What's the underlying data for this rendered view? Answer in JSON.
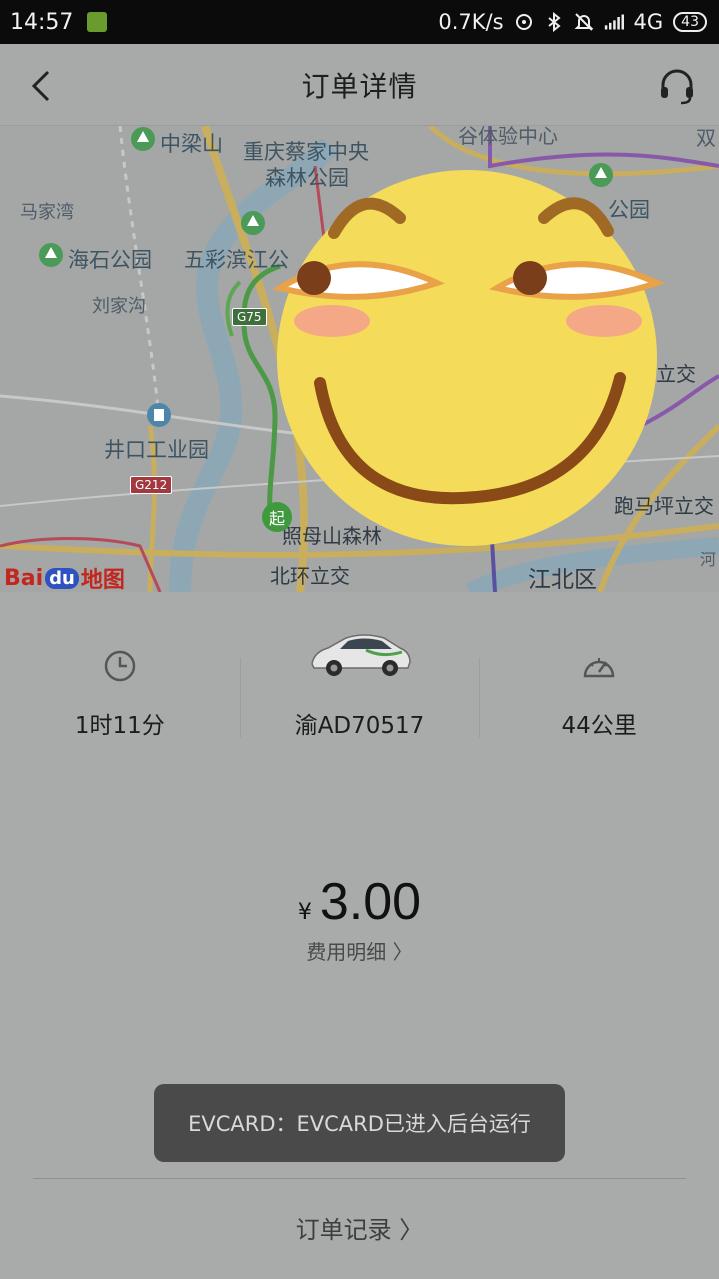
{
  "statusbar": {
    "time": "14:57",
    "speed": "0.7K/s",
    "network": "4G",
    "battery": "43"
  },
  "header": {
    "title": "订单详情"
  },
  "map": {
    "labels": {
      "zhongliangshan": "中梁山",
      "caijia": "重庆蔡家中央",
      "caijia2": "森林公园",
      "tiyan": "谷体验中心",
      "shuang": "双",
      "majiawan": "马家湾",
      "gongyuan_r": "公园",
      "haishi": "海石公园",
      "wucai": "五彩滨江公",
      "liujiagou": "刘家沟",
      "lijiao_r": "立交",
      "jingkou": "井口工业园",
      "paomaping": "跑马坪立交",
      "zhaomushan": "照母山森林",
      "beihuan": "北环立交",
      "jiangbei": "江北区",
      "he": "河"
    },
    "shields": {
      "g75": "G75",
      "g212": "G212"
    },
    "start_marker": "起",
    "logo": {
      "bai": "Bai",
      "du": "du",
      "ditu": "地图"
    }
  },
  "stats": {
    "duration": "1时11分",
    "plate": "渝AD70517",
    "distance": "44公里"
  },
  "price": {
    "currency": "¥",
    "amount": "3.00",
    "detail": "费用明细 〉"
  },
  "toast": {
    "text": "EVCARD：EVCARD已进入后台运行"
  },
  "footer": {
    "order_record": "订单记录 〉"
  }
}
